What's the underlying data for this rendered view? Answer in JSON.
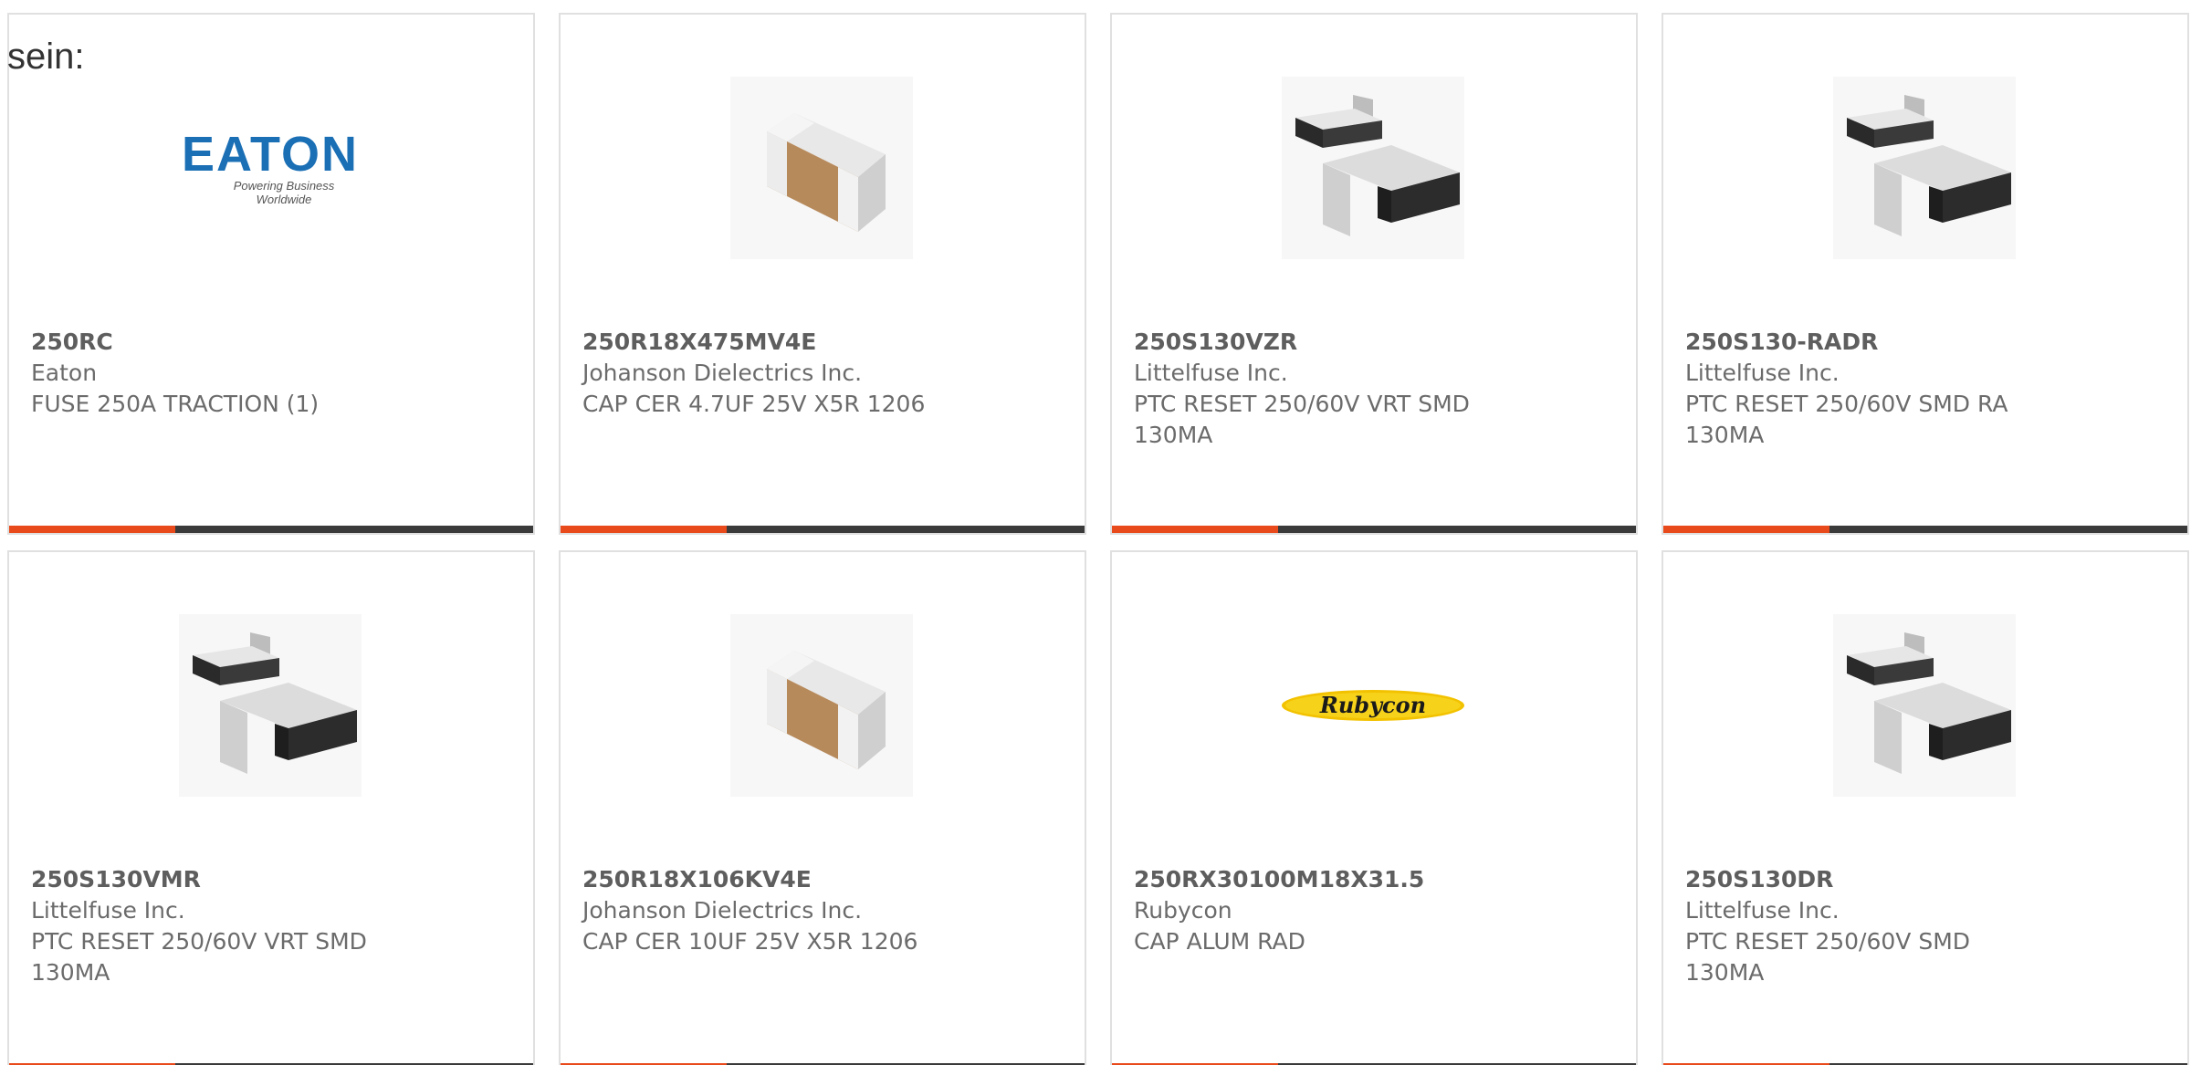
{
  "intro_text": "sein:",
  "colors": {
    "accent": "#e84a1b",
    "bar": "#3a3a3a",
    "border": "#e0e0e0",
    "text": "#6b6b6b"
  },
  "products": [
    {
      "part_number": "250RC",
      "manufacturer": "Eaton",
      "description": "FUSE 250A TRACTION (1)",
      "image": "eaton-logo",
      "logo_text": "EATON",
      "logo_tagline": "Powering Business Worldwide"
    },
    {
      "part_number": "250R18X475MV4E",
      "manufacturer": "Johanson Dielectrics Inc.",
      "description": "CAP CER 4.7UF 25V X5R 1206",
      "image": "ceramic-capacitor-icon"
    },
    {
      "part_number": "250S130VZR",
      "manufacturer": "Littelfuse Inc.",
      "description": "PTC RESET 250/60V VRT SMD 130MA",
      "image": "ptc-fuse-icon"
    },
    {
      "part_number": "250S130-RADR",
      "manufacturer": "Littelfuse Inc.",
      "description": "PTC RESET 250/60V SMD RA 130MA",
      "image": "ptc-fuse-icon"
    },
    {
      "part_number": "250S130VMR",
      "manufacturer": "Littelfuse Inc.",
      "description": "PTC RESET 250/60V VRT SMD 130MA",
      "image": "ptc-fuse-icon"
    },
    {
      "part_number": "250R18X106KV4E",
      "manufacturer": "Johanson Dielectrics Inc.",
      "description": "CAP CER 10UF 25V X5R 1206",
      "image": "ceramic-capacitor-icon"
    },
    {
      "part_number": "250RX30100M18X31.5",
      "manufacturer": "Rubycon",
      "description": "CAP ALUM RAD",
      "image": "rubycon-logo",
      "logo_text": "Rubycon"
    },
    {
      "part_number": "250S130DR",
      "manufacturer": "Littelfuse Inc.",
      "description": "PTC RESET 250/60V SMD 130MA",
      "image": "ptc-fuse-icon"
    }
  ]
}
